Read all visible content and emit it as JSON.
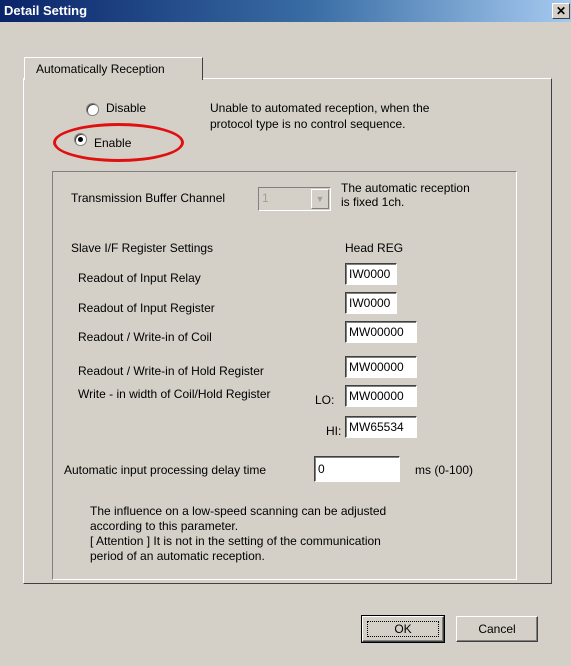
{
  "window": {
    "title": "Detail Setting",
    "close_glyph": "✕"
  },
  "tab": {
    "label": "Automatically Reception"
  },
  "mode": {
    "disable_label": "Disable",
    "enable_label": "Enable",
    "selected": "Enable",
    "note_line1": "Unable to automated reception, when the",
    "note_line2": "protocol type is no control sequence."
  },
  "transmission": {
    "label": "Transmission Buffer Channel",
    "value": "1",
    "note_line1": "The automatic reception",
    "note_line2": "is fixed 1ch."
  },
  "slave": {
    "heading": "Slave I/F Register Settings",
    "head_reg_label": "Head REG",
    "rows": [
      {
        "label": "Readout of Input Relay",
        "value": "IW0000"
      },
      {
        "label": "Readout of Input Register",
        "value": "IW0000"
      },
      {
        "label": "Readout / Write-in of Coil",
        "value": "MW00000"
      },
      {
        "label": "Readout / Write-in of Hold Register",
        "value": "MW00000"
      }
    ],
    "width_label": "Write - in width of Coil/Hold Register",
    "lo_label": "LO:",
    "lo_value": "MW00000",
    "hi_label": "HI:",
    "hi_value": "MW65534"
  },
  "delay": {
    "label": "Automatic input processing delay time",
    "value": "0",
    "unit": "ms (0-100)"
  },
  "info": {
    "line1": "The influence on a low-speed scanning can be adjusted",
    "line2": "according to this parameter.",
    "line3": "[ Attention ] It is not in the setting of the communication",
    "line4": "period of an automatic reception."
  },
  "buttons": {
    "ok": "OK",
    "cancel": "Cancel"
  },
  "colors": {
    "titlebar": "#0a246a",
    "dialog": "#d4d0c8",
    "highlight": "#e01010"
  }
}
